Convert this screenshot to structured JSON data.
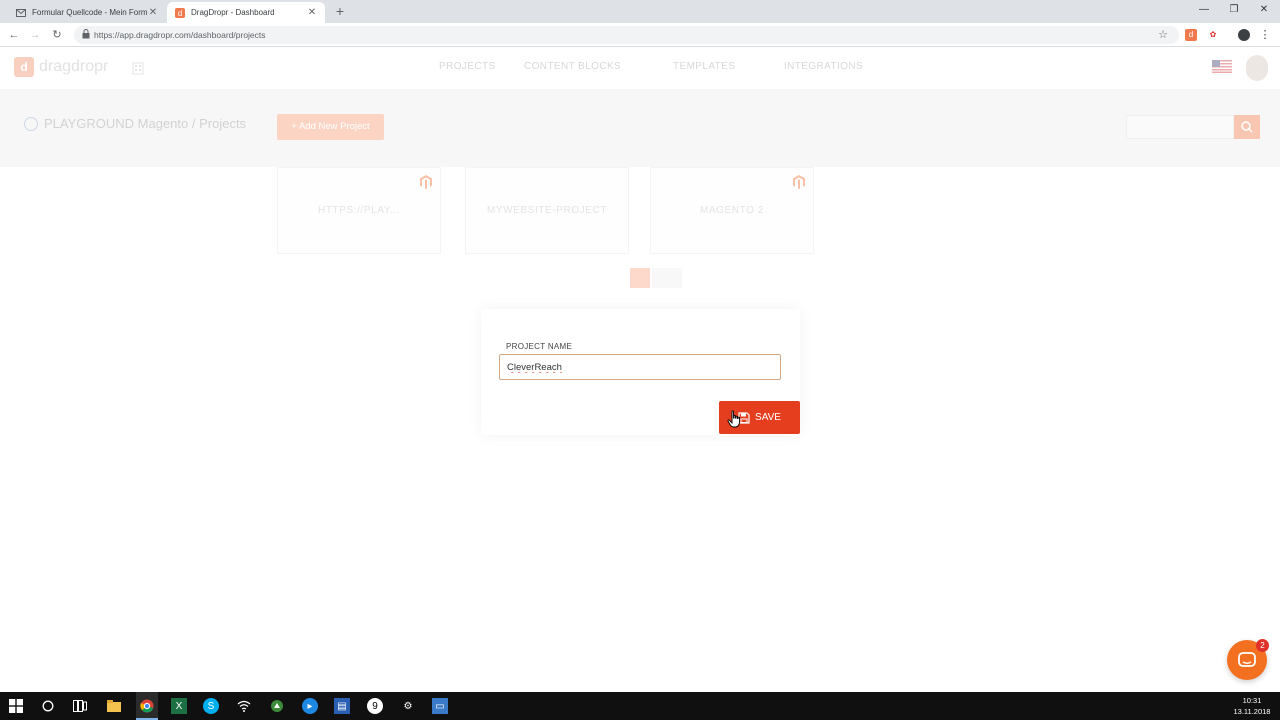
{
  "browser": {
    "tabs": [
      {
        "title": "Formular Quellcode - Mein Form",
        "icon": "mail-icon",
        "active": false
      },
      {
        "title": "DragDropr - Dashboard",
        "icon": "dragdropr-favicon",
        "active": true
      }
    ],
    "url": "https://app.dragdropr.com/dashboard/projects"
  },
  "app": {
    "logo_text": "dragdropr",
    "nav": [
      "PROJECTS",
      "CONTENT BLOCKS",
      "TEMPLATES",
      "INTEGRATIONS"
    ],
    "breadcrumb": "PLAYGROUND Magento / Projects",
    "add_button_label": "+ Add New Project",
    "projects": [
      {
        "name": "HTTPS://PLAY...",
        "platform_icon": "magento-icon"
      },
      {
        "name": "MYWEBSITE-PROJECT",
        "platform_icon": ""
      },
      {
        "name": "MAGENTO 2",
        "platform_icon": "magento-icon"
      }
    ]
  },
  "modal": {
    "label": "PROJECT NAME",
    "input_value": "CleverReach",
    "save_label": "SAVE"
  },
  "chat": {
    "badge_count": "2"
  },
  "taskbar": {
    "time": "10:31",
    "date": "13.11.2018"
  },
  "colors": {
    "accent": "#e53e1f",
    "accent_faded": "#fbd4c4",
    "chat": "#f37021"
  }
}
